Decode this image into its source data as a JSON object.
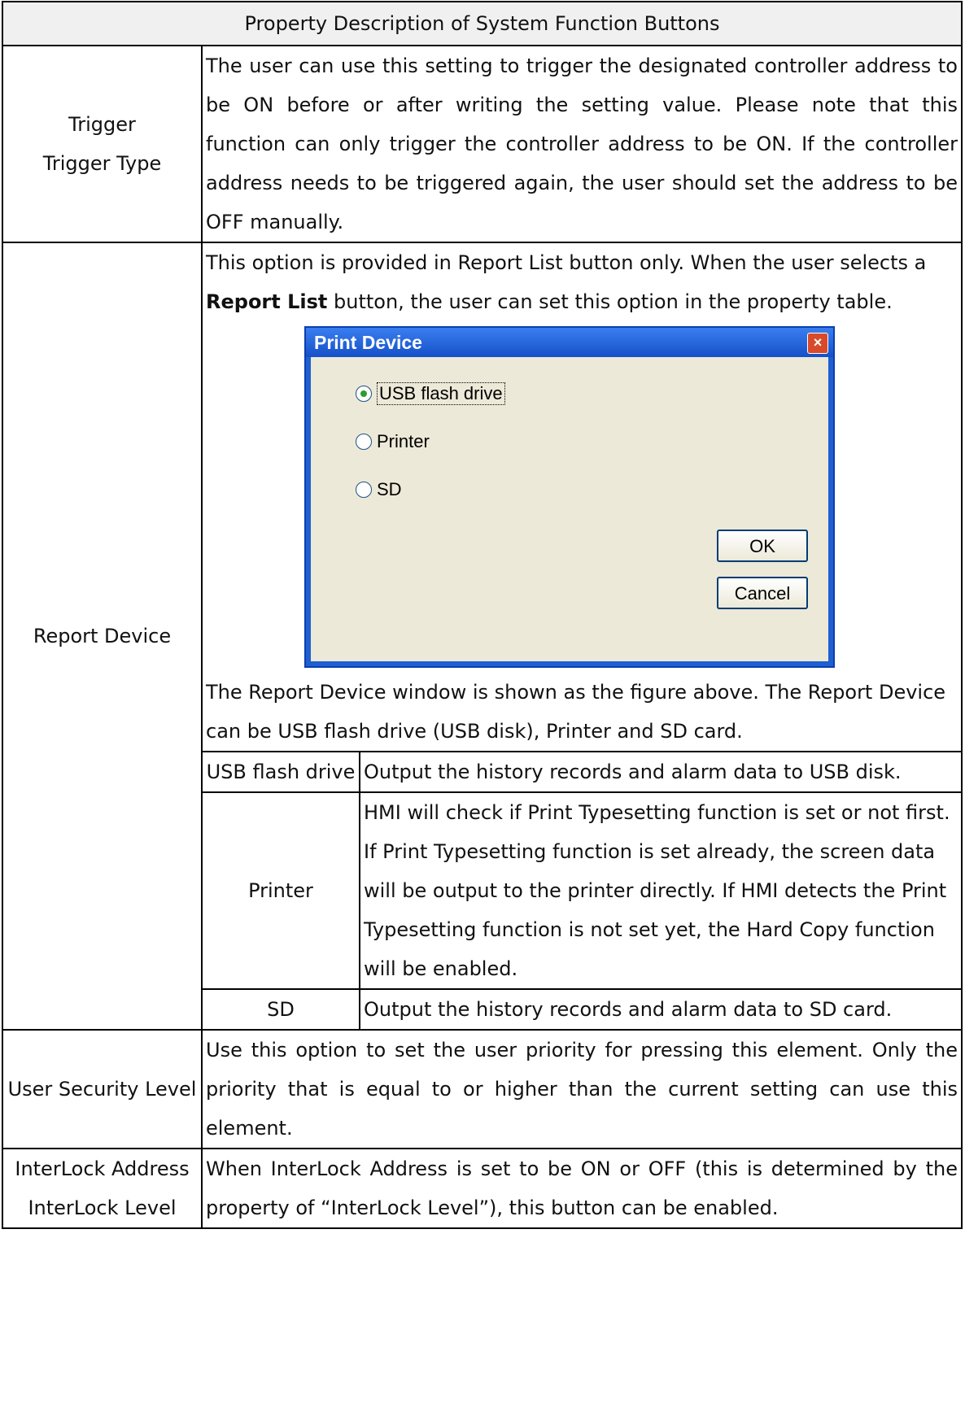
{
  "table": {
    "header": "Property Description of System Function Buttons",
    "rows": {
      "trigger": {
        "label_line1": "Trigger",
        "label_line2": "Trigger Type",
        "description": "The user can use this setting to trigger the designated controller address to be ON before or after writing the setting value. Please note that this function can only trigger the controller address to be ON. If the controller address needs to be triggered again, the user should set the address to be OFF manually."
      },
      "report_device": {
        "label": "Report Device",
        "intro_part1": "This option is provided in Report List button only. When the user selects a ",
        "intro_bold": "Report List",
        "intro_part2": " button, the user can set this option in the property table.",
        "after_figure": "The Report Device window is shown as the figure above. The Report Device can be USB flash drive (USB disk), Printer and SD card.",
        "options": [
          {
            "name": "USB flash drive",
            "description": "Output the history records and alarm data to USB disk."
          },
          {
            "name": "Printer",
            "description": "HMI will check if Print Typesetting function is set or not first. If Print Typesetting function is set already, the screen data will be output to the printer directly. If HMI detects the Print Typesetting function is not set yet, the Hard Copy function will be enabled."
          },
          {
            "name": "SD",
            "description": "Output the history records and alarm data to SD card."
          }
        ]
      },
      "user_security": {
        "label": "User Security Level",
        "description": "Use this option to set the user priority for pressing this element. Only the priority that is equal to or higher than the current setting can use this element."
      },
      "interlock": {
        "label_line1": "InterLock Address",
        "label_line2": "InterLock Level",
        "description": "When InterLock Address is set to be ON or OFF (this is determined by the property of “InterLock Level”), this button can be enabled."
      }
    }
  },
  "dialog": {
    "title": "Print Device",
    "close_icon": "close-icon",
    "options": [
      "USB flash drive",
      "Printer",
      "SD"
    ],
    "selected": "USB flash drive",
    "ok_label": "OK",
    "cancel_label": "Cancel"
  }
}
